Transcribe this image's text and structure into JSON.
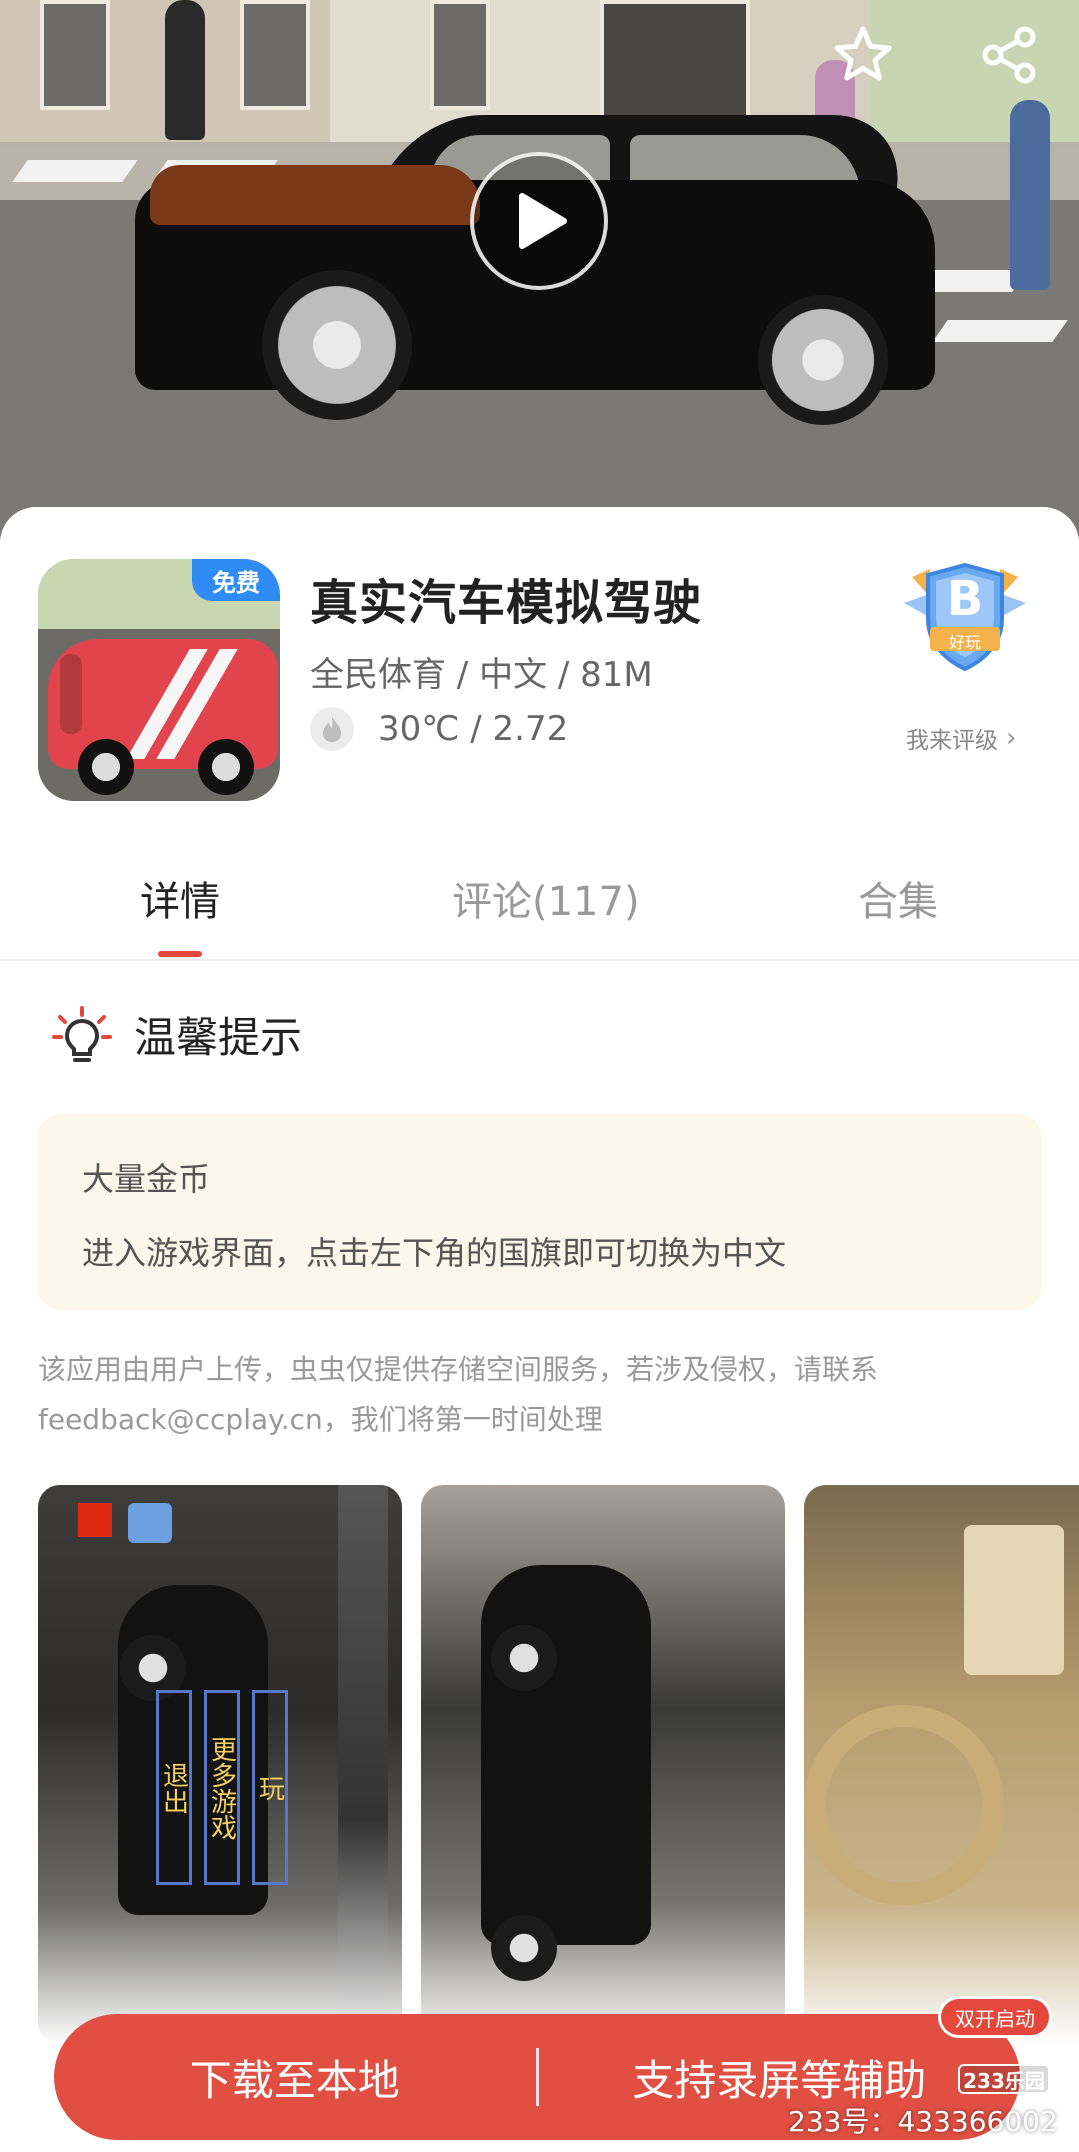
{
  "header": {
    "favorite_icon": "star-outline-icon",
    "share_icon": "share-icon",
    "play_icon": "play-icon"
  },
  "app": {
    "badge": "免费",
    "title": "真实汽车模拟驾驶",
    "meta": "全民体育 / 中文 / 81M",
    "heat": "30℃ / 2.72",
    "rating_grade": "B",
    "rating_label": "好玩",
    "rate_link": "我来评级"
  },
  "tabs": [
    {
      "label": "详情",
      "active": true
    },
    {
      "label": "评论(117)",
      "active": false
    },
    {
      "label": "合集",
      "active": false
    }
  ],
  "tips": {
    "title": "温馨提示",
    "line1": "大量金币",
    "line2": "进入游戏界面，点击左下角的国旗即可切换为中文"
  },
  "disclaimer": {
    "line1": "该应用由用户上传，虫虫仅提供存储空间服务，若涉及侵权，请联系",
    "line2": "feedback@ccplay.cn，我们将第一时间处理"
  },
  "screenshots": {
    "shot1_buttons": [
      "退出",
      "更多游戏",
      "玩"
    ]
  },
  "bottom": {
    "double_start": "双开启动",
    "download": "下载至本地",
    "assist": "支持录屏等辅助",
    "logo": "233乐园",
    "watermark": "233号：433366002"
  },
  "colors": {
    "accent": "#e04f42",
    "badge_blue": "#2f8cf5",
    "tips_bg": "#fdf6ea"
  }
}
